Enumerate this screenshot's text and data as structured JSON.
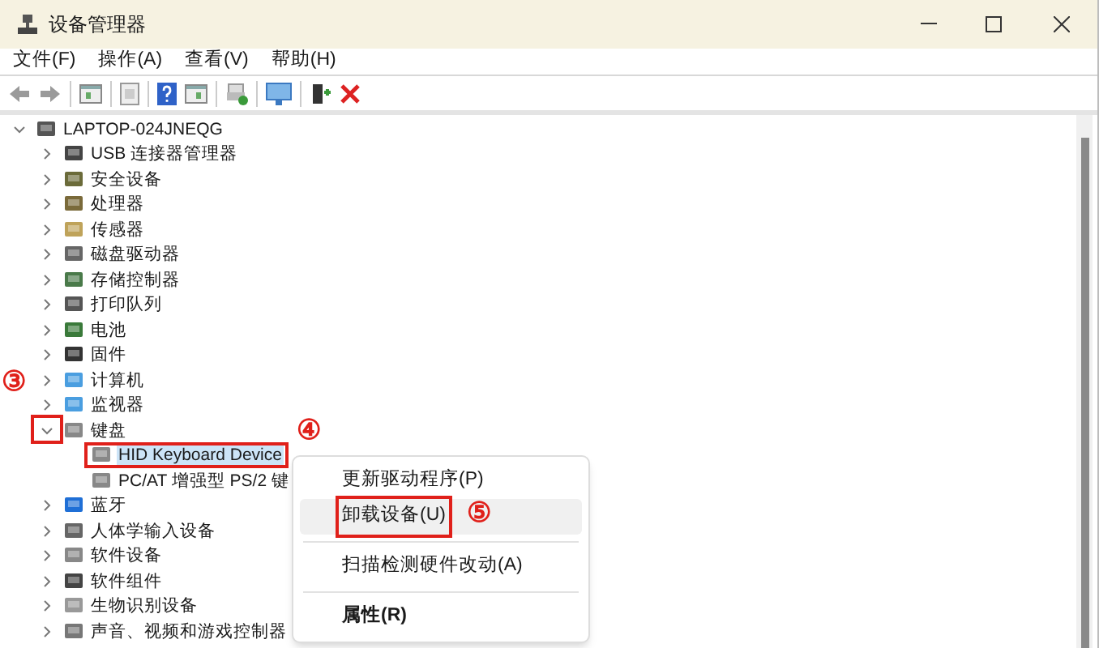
{
  "window": {
    "title": "设备管理器"
  },
  "menu": [
    "文件(F)",
    "操作(A)",
    "查看(V)",
    "帮助(H)"
  ],
  "tree": {
    "label": "LAPTOP-024JNEQG",
    "expanded": true,
    "selected": false,
    "children": [
      {
        "label": "USB 连接器管理器",
        "expanded": false,
        "selected": false
      },
      {
        "label": "安全设备",
        "expanded": false,
        "selected": false
      },
      {
        "label": "处理器",
        "expanded": false,
        "selected": false
      },
      {
        "label": "传感器",
        "expanded": false,
        "selected": false
      },
      {
        "label": "磁盘驱动器",
        "expanded": false,
        "selected": false
      },
      {
        "label": "存储控制器",
        "expanded": false,
        "selected": false
      },
      {
        "label": "打印队列",
        "expanded": false,
        "selected": false
      },
      {
        "label": "电池",
        "expanded": false,
        "selected": false
      },
      {
        "label": "固件",
        "expanded": false,
        "selected": false
      },
      {
        "label": "计算机",
        "expanded": false,
        "selected": false
      },
      {
        "label": "监视器",
        "expanded": false,
        "selected": false
      },
      {
        "label": "键盘",
        "expanded": true,
        "selected": false,
        "callout": {
          "kind": "chevron",
          "number": "③"
        },
        "children": [
          {
            "label": "HID Keyboard Device",
            "selected": true,
            "callout": {
              "kind": "label",
              "number": "④"
            }
          },
          {
            "label": "PC/AT 增强型 PS/2 键",
            "selected": false
          }
        ]
      },
      {
        "label": "蓝牙",
        "expanded": false,
        "selected": false
      },
      {
        "label": "人体学输入设备",
        "expanded": false,
        "selected": false
      },
      {
        "label": "软件设备",
        "expanded": false,
        "selected": false
      },
      {
        "label": "软件组件",
        "expanded": false,
        "selected": false
      },
      {
        "label": "生物识别设备",
        "expanded": false,
        "selected": false
      },
      {
        "label": "声音、视频和游戏控制器",
        "expanded": false,
        "selected": false
      }
    ]
  },
  "context_menu": [
    {
      "kind": "item",
      "label": "更新驱动程序(P)",
      "highlighted": false,
      "bold": false
    },
    {
      "kind": "item",
      "label": "卸载设备(U)",
      "highlighted": true,
      "bold": false,
      "callout": {
        "kind": "label",
        "number": "⑤"
      }
    },
    {
      "kind": "separator"
    },
    {
      "kind": "item",
      "label": "扫描检测硬件改动(A)",
      "highlighted": false,
      "bold": false
    },
    {
      "kind": "separator"
    },
    {
      "kind": "item",
      "label": "属性(R)",
      "highlighted": false,
      "bold": true
    }
  ]
}
